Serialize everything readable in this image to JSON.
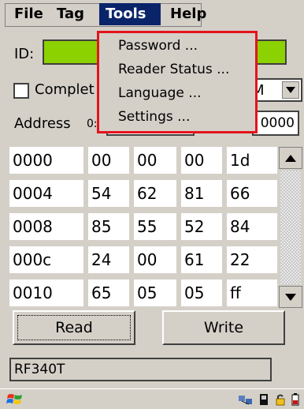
{
  "menubar": {
    "items": [
      {
        "label": "File"
      },
      {
        "label": "Tag"
      },
      {
        "label": "Tools"
      },
      {
        "label": "Help"
      }
    ]
  },
  "tools_menu": {
    "items": [
      {
        "label": "Password ..."
      },
      {
        "label": "Reader Status ..."
      },
      {
        "label": "Language ..."
      },
      {
        "label": "Settings ..."
      }
    ]
  },
  "form": {
    "id_label": "ID:",
    "checkbox_label": "Complet",
    "combo_value": "M",
    "address_label": "Address",
    "address_prefix": "0:",
    "address_end": "0000"
  },
  "grid": {
    "rows": [
      {
        "address": "0000",
        "cells": [
          "00",
          "00",
          "00",
          "1d"
        ]
      },
      {
        "address": "0004",
        "cells": [
          "54",
          "62",
          "81",
          "66"
        ]
      },
      {
        "address": "0008",
        "cells": [
          "85",
          "55",
          "52",
          "84"
        ]
      },
      {
        "address": "000c",
        "cells": [
          "24",
          "00",
          "61",
          "22"
        ]
      },
      {
        "address": "0010",
        "cells": [
          "65",
          "05",
          "05",
          "ff"
        ]
      }
    ]
  },
  "buttons": {
    "read": "Read",
    "write": "Write"
  },
  "status_text": "RF340T",
  "colors": {
    "id_field": "#8cd100",
    "menu_highlight": "#0a246a",
    "dropdown_border": "#e4141c"
  }
}
